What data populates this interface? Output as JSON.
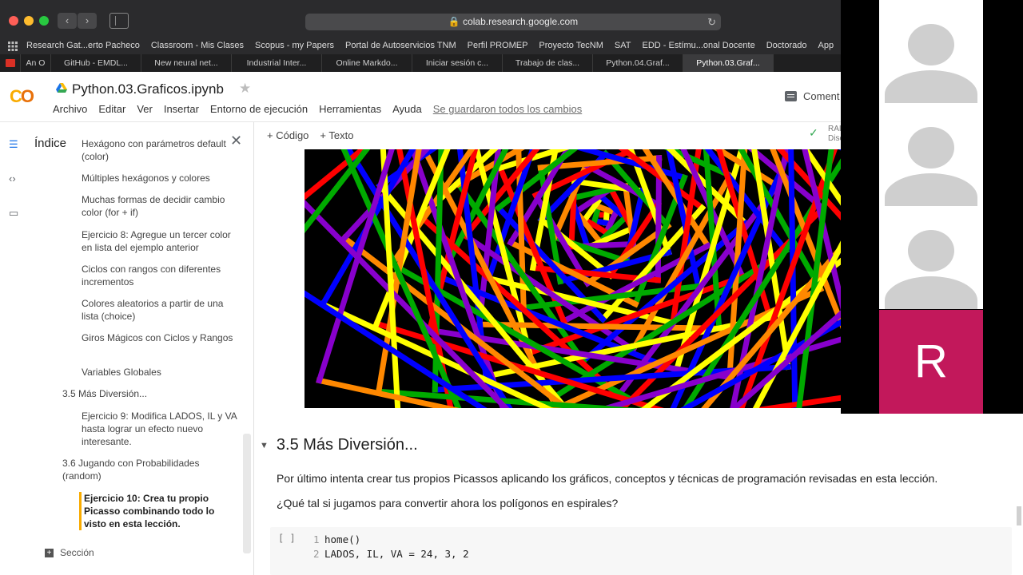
{
  "browser": {
    "url": "colab.research.google.com",
    "bookmarks": [
      "Research Gat...erto Pacheco",
      "Classroom - Mis Clases",
      "Scopus - my Papers",
      "Portal de Autoservicios TNM",
      "Perfil PROMEP",
      "Proyecto TecNM",
      "SAT",
      "EDD - Estímu...onal Docente",
      "Doctorado",
      "App"
    ],
    "tabs": [
      "An O",
      "GitHub - EMDL...",
      "New neural net...",
      "Industrial Inter...",
      "Online Markdo...",
      "Iniciar sesión c...",
      "Trabajo de clas...",
      "Python.04.Graf...",
      "Python.03.Graf..."
    ],
    "active_tab_index": 8
  },
  "colab": {
    "logo": "CO",
    "notebook_title": "Python.03.Graficos.ipynb",
    "menu": [
      "Archivo",
      "Editar",
      "Ver",
      "Insertar",
      "Entorno de ejecución",
      "Herramientas",
      "Ayuda"
    ],
    "saved_status": "Se guardaron todos los cambios",
    "comment_label": "Coment",
    "add_code": "+ Código",
    "add_text": "+ Texto",
    "ram_label": "RAI",
    "disk_label": "Disc"
  },
  "toc": {
    "title": "Índice",
    "items": [
      {
        "text": "Hexágono con parámetros default (color)",
        "level": 2
      },
      {
        "text": "Múltiples hexágonos y colores",
        "level": 2
      },
      {
        "text": "Muchas formas de decidir cambio color (for + if)",
        "level": 2
      },
      {
        "text": "Ejercicio 8: Agregue un tercer color en lista del ejemplo anterior",
        "level": 2
      },
      {
        "text": "Ciclos con rangos con diferentes incrementos",
        "level": 2
      },
      {
        "text": "Colores aleatorios a partir de una lista (choice)",
        "level": 2
      },
      {
        "text": "Giros Mágicos con Ciclos y Rangos",
        "level": 2
      },
      {
        "text": "Variables Globales",
        "level": 2
      },
      {
        "text": "3.5 Más Diversión...",
        "level": 1
      },
      {
        "text": "Ejercicio 9: Modifica LADOS, IL y VA hasta lograr un efecto nuevo interesante.",
        "level": 2
      },
      {
        "text": "3.6 Jugando con Probabilidades (random)",
        "level": 1
      },
      {
        "text": "Ejercicio 10: Crea tu propio Picasso combinando todo lo visto en esta lección.",
        "level": 2,
        "active": true
      }
    ],
    "add_section": "Sección"
  },
  "content": {
    "heading": "3.5 Más Diversión...",
    "paragraph1": "Por último intenta crear tus propios Picassos aplicando los gráficos, conceptos y técnicas de programación revisadas en esta lección.",
    "paragraph2": "¿Qué tal si jugamos para convertir ahora los polígonos en espirales?",
    "run_indicator": "[ ]",
    "code_lines": [
      {
        "n": "1",
        "code": "home()"
      },
      {
        "n": "2",
        "code": "LADOS, IL, VA = 24, 3, 2"
      }
    ]
  },
  "video": {
    "participant_initial": "R",
    "accent": "#c2185b"
  },
  "art_colors": [
    "#ff0000",
    "#ffff00",
    "#0000ff",
    "#00aa00",
    "#ff8800",
    "#8800cc"
  ]
}
